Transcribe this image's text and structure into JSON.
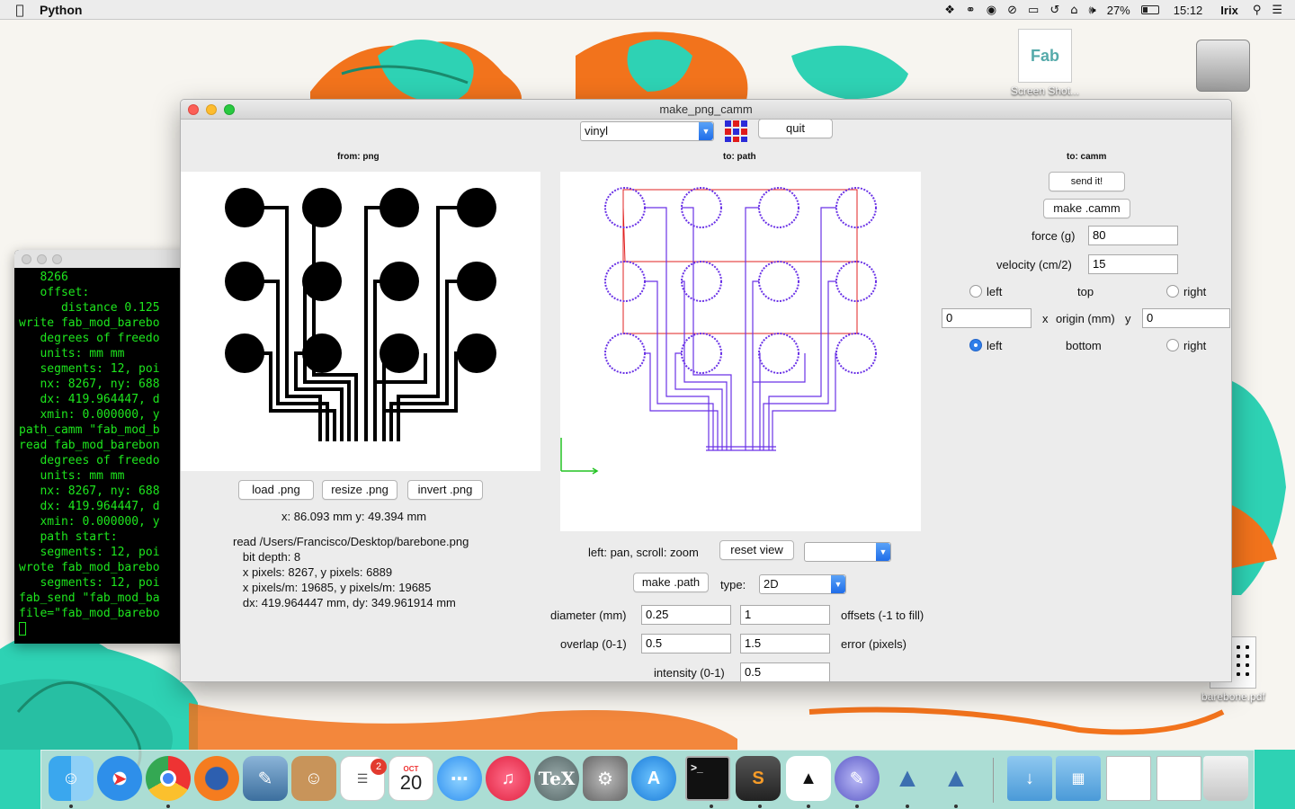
{
  "menubar": {
    "app_name": "Python",
    "battery": "27%",
    "time": "15:12",
    "user": "Irix",
    "status_icons": [
      "dropbox-icon",
      "glasses-icon",
      "clock-circle-icon",
      "do-not-disturb-icon",
      "airplay-icon",
      "time-machine-icon",
      "wifi-icon",
      "volume-icon",
      "battery-icon",
      "spotlight-icon",
      "notification-center-icon"
    ]
  },
  "desktop": {
    "icons": [
      {
        "name": "fab-cafe-icon",
        "label": "Screen Shot..."
      },
      {
        "name": "hard-drive-icon",
        "label": ""
      },
      {
        "name": "pdf-file-icon",
        "label": "barebone.pdf"
      }
    ]
  },
  "terminal": {
    "lines": [
      "   8266",
      "   offset:",
      "      distance 0.125",
      "write fab_mod_barebo",
      "   degrees of freedo",
      "   units: mm mm",
      "   segments: 12, poi",
      "   nx: 8267, ny: 688",
      "   dx: 419.964447, d",
      "   xmin: 0.000000, y",
      "path_camm \"fab_mod_b",
      "read fab_mod_barebon",
      "   degrees of freedo",
      "   units: mm mm",
      "   nx: 8267, ny: 688",
      "   dx: 419.964447, d",
      "   xmin: 0.000000, y",
      "   path start:",
      "   segments: 12, poi",
      "wrote fab_mod_barebo",
      "   segments: 12, poi",
      "fab_send \"fab_mod_ba",
      "file=\"fab_mod_barebo"
    ]
  },
  "window": {
    "title": "make_png_camm",
    "machine_select": "vinyl",
    "quit_label": "quit",
    "from_header": "from: png",
    "to_path_header": "to: path",
    "to_camm_header": "to: camm",
    "load_png": "load .png",
    "resize_png": "resize .png",
    "invert_png": "invert .png",
    "coords": "x: 86.093 mm  y: 49.394 mm",
    "file_info": [
      "read /Users/Francisco/Desktop/barebone.png",
      "   bit depth: 8",
      "   x pixels: 8267, y pixels: 6889",
      "   x pixels/m: 19685, y pixels/m: 19685",
      "   dx: 419.964447 mm, dy: 349.961914 mm"
    ],
    "pan_hint": "left: pan, scroll: zoom",
    "reset_view": "reset view",
    "view_select": "",
    "make_path": "make .path",
    "type_label": "type:",
    "type_value": "2D",
    "diameter_label": "diameter (mm)",
    "diameter_value": "0.25",
    "offsets_value": "1",
    "offsets_label": "offsets (-1 to fill)",
    "overlap_label": "overlap (0-1)",
    "overlap_value": "0.5",
    "error_value": "1.5",
    "error_label": "error (pixels)",
    "intensity_label": "intensity (0-1)",
    "intensity_value": "0.5",
    "send_it": "send it!",
    "make_camm": "make .camm",
    "force_label": "force (g)",
    "force_value": "80",
    "velocity_label": "velocity (cm/2)",
    "velocity_value": "15",
    "left_label": "left",
    "top_label": "top",
    "right_label": "right",
    "bottom_label": "bottom",
    "x_label": "x",
    "origin_label": "origin (mm)",
    "y_label": "y",
    "origin_x": "0",
    "origin_y": "0",
    "origin_selected": "bottom-left"
  },
  "dock": {
    "calendar_month": "OCT",
    "calendar_day": "20",
    "reminders_badge": "2",
    "items": [
      "finder-icon",
      "safari-icon",
      "chrome-icon",
      "firefox-icon",
      "preview-icon",
      "contacts-icon",
      "reminders-icon",
      "calendar-icon",
      "messages-icon",
      "itunes-icon",
      "tex-icon",
      "system-preferences-icon",
      "app-store-icon",
      "terminal-icon",
      "sublime-text-icon",
      "inkscape-icon",
      "script-editor-icon",
      "python-launcher-icon",
      "python-launcher-icon",
      "downloads-folder-icon",
      "applications-folder-icon",
      "documents-stack-icon",
      "files-stack-icon",
      "trash-icon"
    ]
  },
  "colors": {
    "wallpaper_teal": "#2ed2b4",
    "wallpaper_orange": "#f2731c",
    "path_purple": "#6a32e6",
    "path_red": "#e12020",
    "radio_blue": "#2f7ee9",
    "terminal_green": "#1ee61e"
  }
}
